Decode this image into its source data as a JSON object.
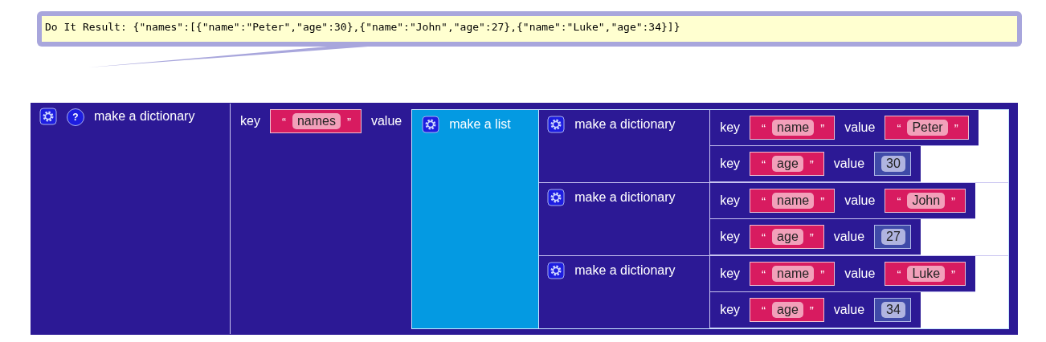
{
  "result_bubble": {
    "text": "Do It Result: {\"names\":[{\"name\":\"Peter\",\"age\":30},{\"name\":\"John\",\"age\":27},{\"name\":\"Luke\",\"age\":34}]}"
  },
  "block": {
    "kind": "dictionary",
    "label": "make a dictionary",
    "help": "?",
    "pairs": [
      {
        "key_label": "key",
        "key": {
          "kind": "text",
          "open_quote": "“",
          "value": "names",
          "close_quote": "”"
        },
        "value_label": "value",
        "value": {
          "kind": "list",
          "label": "make a list",
          "items": [
            {
              "kind": "dictionary",
              "label": "make a dictionary",
              "pairs": [
                {
                  "key_label": "key",
                  "key": {
                    "kind": "text",
                    "open_quote": "“",
                    "value": "name",
                    "close_quote": "”"
                  },
                  "value_label": "value",
                  "value": {
                    "kind": "text",
                    "open_quote": "“",
                    "value": "Peter",
                    "close_quote": "”"
                  }
                },
                {
                  "key_label": "key",
                  "key": {
                    "kind": "text",
                    "open_quote": "“",
                    "value": "age",
                    "close_quote": "”"
                  },
                  "value_label": "value",
                  "value": {
                    "kind": "number",
                    "value": "30"
                  }
                }
              ]
            },
            {
              "kind": "dictionary",
              "label": "make a dictionary",
              "pairs": [
                {
                  "key_label": "key",
                  "key": {
                    "kind": "text",
                    "open_quote": "“",
                    "value": "name",
                    "close_quote": "”"
                  },
                  "value_label": "value",
                  "value": {
                    "kind": "text",
                    "open_quote": "“",
                    "value": "John",
                    "close_quote": "”"
                  }
                },
                {
                  "key_label": "key",
                  "key": {
                    "kind": "text",
                    "open_quote": "“",
                    "value": "age",
                    "close_quote": "”"
                  },
                  "value_label": "value",
                  "value": {
                    "kind": "number",
                    "value": "27"
                  }
                }
              ]
            },
            {
              "kind": "dictionary",
              "label": "make a dictionary",
              "pairs": [
                {
                  "key_label": "key",
                  "key": {
                    "kind": "text",
                    "open_quote": "“",
                    "value": "name",
                    "close_quote": "”"
                  },
                  "value_label": "value",
                  "value": {
                    "kind": "text",
                    "open_quote": "“",
                    "value": "Luke",
                    "close_quote": "”"
                  }
                },
                {
                  "key_label": "key",
                  "key": {
                    "kind": "text",
                    "open_quote": "“",
                    "value": "age",
                    "close_quote": "”"
                  },
                  "value_label": "value",
                  "value": {
                    "kind": "number",
                    "value": "34"
                  }
                }
              ]
            }
          ]
        }
      }
    ]
  }
}
